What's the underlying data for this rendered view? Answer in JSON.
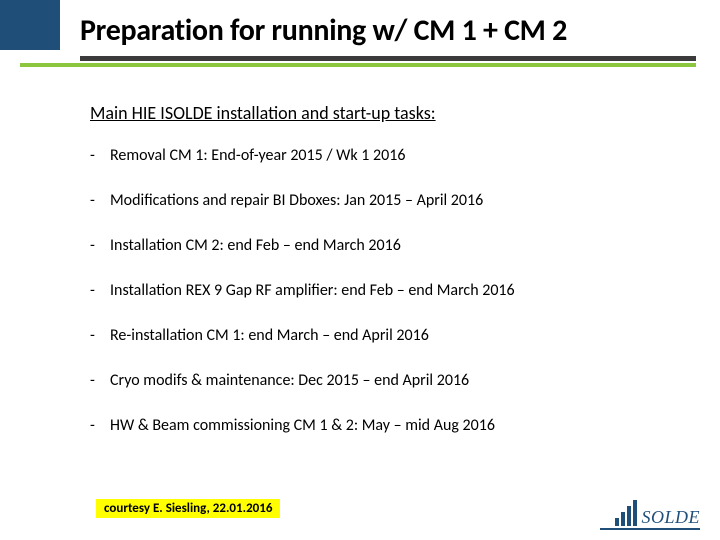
{
  "title": "Preparation for running w/ CM 1 + CM 2",
  "subheading": "Main HIE ISOLDE installation and start-up tasks:",
  "tasks": [
    "Removal CM 1: End-of-year 2015 / Wk 1 2016",
    "Modifications and repair BI Dboxes: Jan 2015 – April 2016",
    "Installation CM 2: end Feb – end March 2016",
    "Installation REX 9 Gap RF amplifier: end Feb – end March 2016",
    "Re-installation CM 1: end March – end April 2016",
    "Cryo modifs & maintenance: Dec 2015 – end April 2016",
    "HW & Beam commissioning CM 1 & 2: May – mid Aug 2016"
  ],
  "credit": "courtesy E. Siesling, 22.01.2016",
  "logo_text": "SOLDE"
}
